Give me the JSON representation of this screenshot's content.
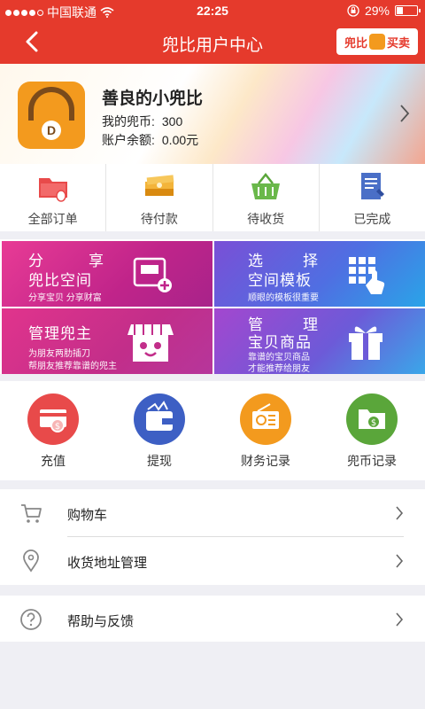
{
  "status_bar": {
    "carrier": "中国联通",
    "time": "22:25",
    "battery": "29%"
  },
  "nav": {
    "back_icon": "back-arrow-icon",
    "title": "兜比用户中心",
    "logo_text_left": "兜比",
    "logo_text_right": "买卖"
  },
  "profile": {
    "name": "善良的小兜比",
    "coins_label": "我的兜币:",
    "coins_value": "300",
    "balance_label": "账户余额:",
    "balance_value": "0.00元",
    "avatar_letter": "D"
  },
  "orders": [
    {
      "label": "全部订单",
      "icon": "folder-mouse-icon"
    },
    {
      "label": "待付款",
      "icon": "money-stack-icon"
    },
    {
      "label": "待收货",
      "icon": "basket-icon"
    },
    {
      "label": "已完成",
      "icon": "document-pen-icon"
    }
  ],
  "tiles": {
    "share": {
      "line1_a": "分",
      "line1_b": "享",
      "line2": "兜比空间",
      "sub": "分享宝贝 分享财富"
    },
    "template": {
      "line1_a": "选",
      "line1_b": "择",
      "line2": "空间模板",
      "sub": "顺眼的模板很重要"
    },
    "owner": {
      "line1": "管理兜主",
      "sub1": "为朋友两肋插刀",
      "sub2": "帮朋友推荐靠谱的兜主"
    },
    "goods": {
      "line1_a": "管",
      "line1_b": "理",
      "line2": "宝贝商品",
      "sub1": "靠谱的宝贝商品",
      "sub2": "才能推荐给朋友"
    }
  },
  "wallet": [
    {
      "label": "充值",
      "icon": "recharge-card-icon",
      "color": "#e84a4a"
    },
    {
      "label": "提现",
      "icon": "wallet-icon",
      "color": "#3d5fc4"
    },
    {
      "label": "财务记录",
      "icon": "radio-ledger-icon",
      "color": "#f39a1e"
    },
    {
      "label": "兜币记录",
      "icon": "coin-folder-icon",
      "color": "#5aa63a"
    }
  ],
  "menu": [
    {
      "label": "购物车",
      "icon": "cart-icon"
    },
    {
      "label": "收货地址管理",
      "icon": "location-pin-icon"
    },
    {
      "label": "帮助与反馈",
      "icon": "help-circle-icon"
    }
  ],
  "colors": {
    "brand_red": "#e53a2c",
    "background": "#efeff4"
  }
}
